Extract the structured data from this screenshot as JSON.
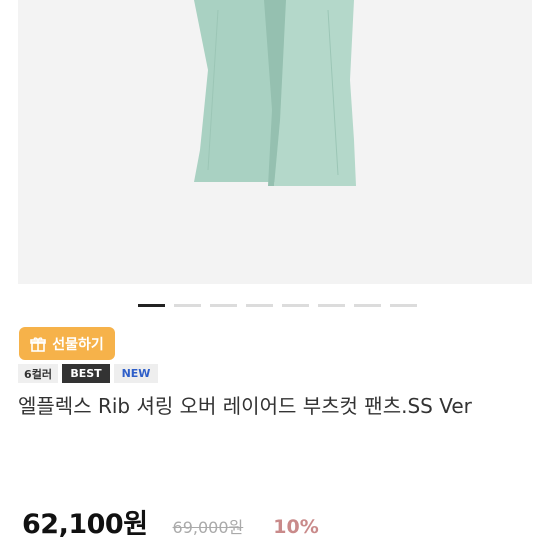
{
  "product": {
    "gift_button_label": "선물하기",
    "badges": {
      "colors": "6컬러",
      "best": "BEST",
      "new": "NEW"
    },
    "title": "엘플렉스 Rib 셔링 오버 레이어드 부츠컷 팬츠.SS Ver",
    "price": "62,100원",
    "original_price": "69,000원",
    "discount": "10%"
  },
  "gallery": {
    "slide_count": 8,
    "active_index": 0,
    "pants_color": "#a9d1c2"
  },
  "colors": {
    "gift_button": "#f6b24a",
    "new_badge_text": "#2f5fc9",
    "discount": "#c98a8a",
    "best_badge_bg": "#333333"
  },
  "icons": {
    "gift": "gift-icon"
  }
}
